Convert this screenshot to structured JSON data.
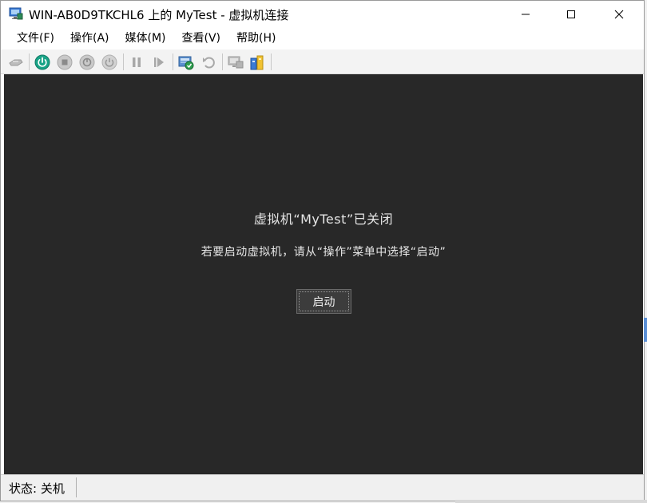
{
  "window": {
    "title": "WIN-AB0D9TKCHL6 上的 MyTest - 虚拟机连接"
  },
  "menu": [
    {
      "label": "文件(F)"
    },
    {
      "label": "操作(A)"
    },
    {
      "label": "媒体(M)"
    },
    {
      "label": "查看(V)"
    },
    {
      "label": "帮助(H)"
    }
  ],
  "toolbar": {
    "icons": [
      "ctrl-alt-del-icon",
      "start-icon",
      "turn-off-icon",
      "shutdown-icon",
      "save-icon",
      "pause-icon",
      "reset-icon",
      "checkpoint-icon",
      "revert-icon",
      "enhanced-session-icon",
      "share-icon"
    ]
  },
  "vm": {
    "heading": "虚拟机“MyTest”已关闭",
    "subtext": "若要启动虚拟机，请从“操作”菜单中选择“启动”",
    "start_label": "启动"
  },
  "status": {
    "text": "状态: 关机"
  },
  "colors": {
    "vm_background": "#282828",
    "start_icon": "#1aa387",
    "accent": "#0078d7"
  }
}
